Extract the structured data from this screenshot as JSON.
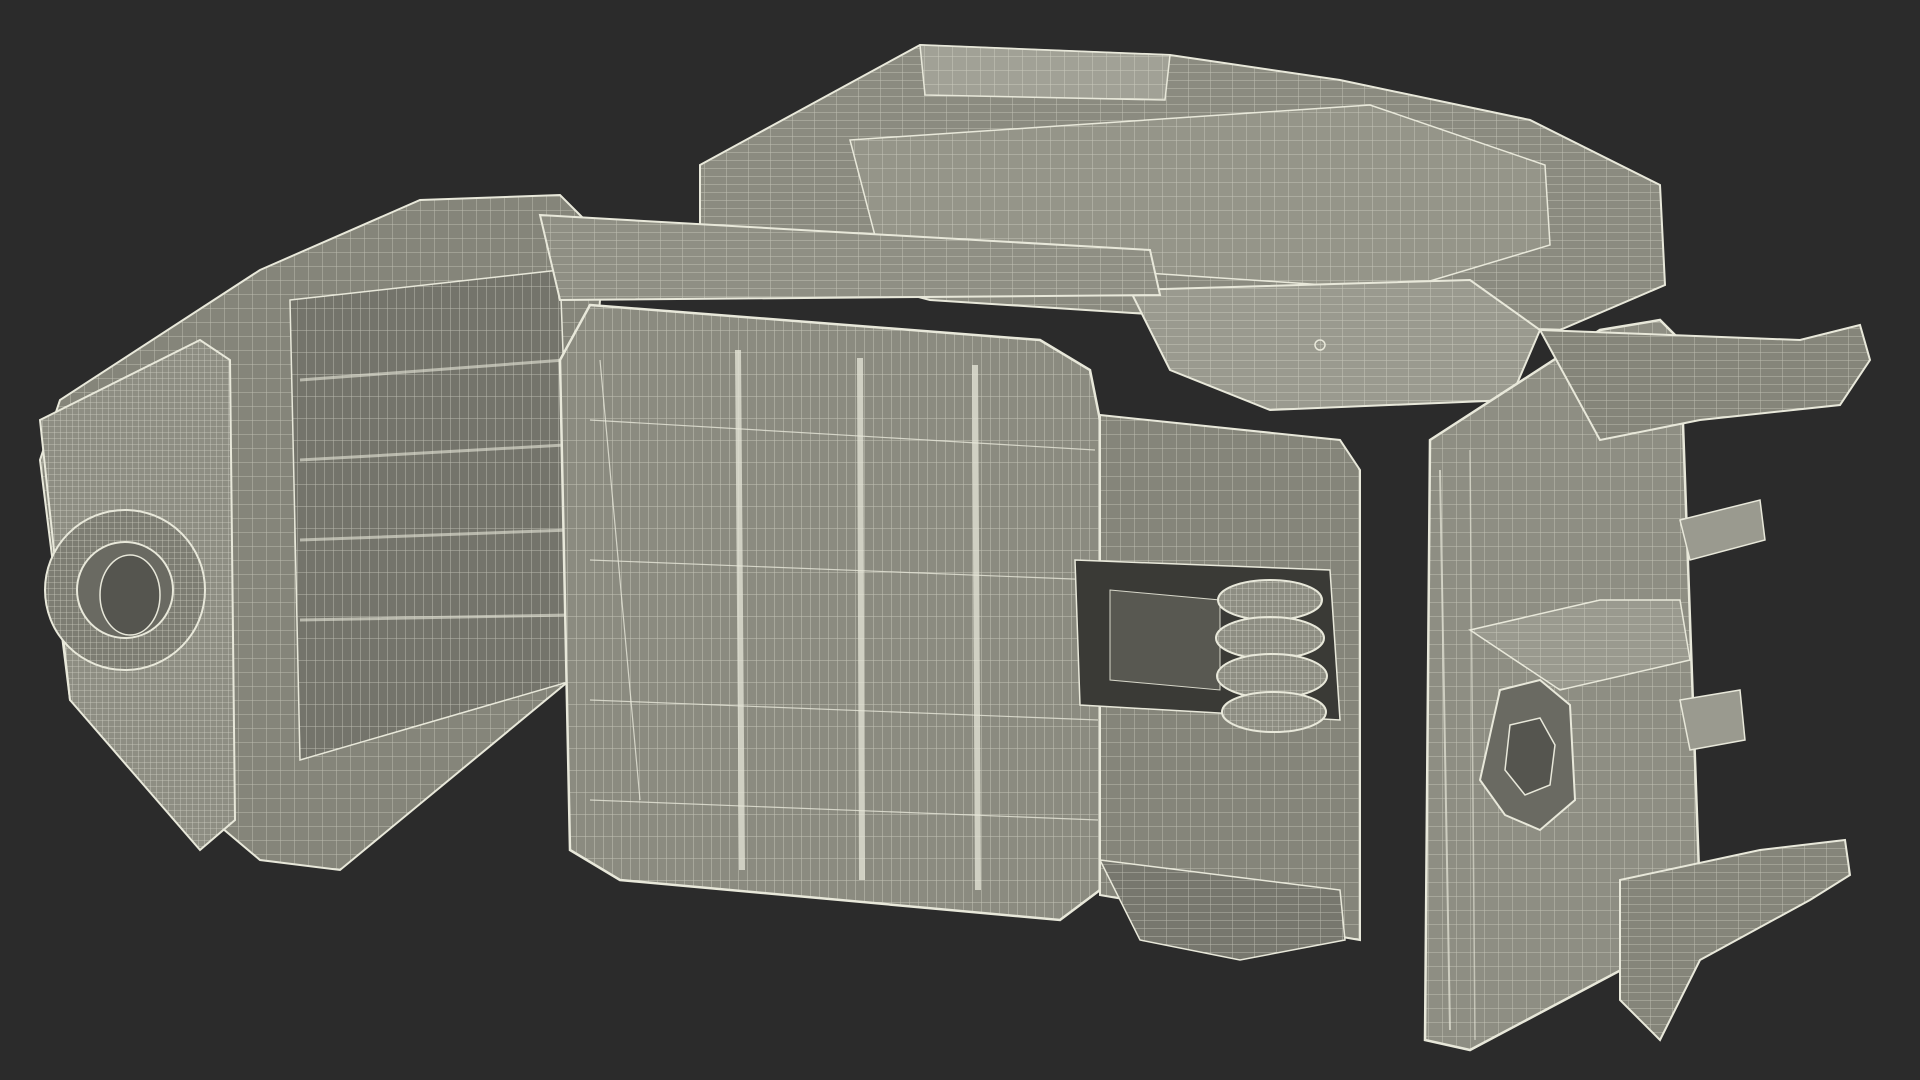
{
  "scene": {
    "background_color": "#2b2b2b",
    "surface_color": "#8b8b80",
    "surface_dark_color": "#6a6a62",
    "surface_light_color": "#a1a196",
    "wire_color": "#e8e8da",
    "subject": "wireframe-mechanical-part"
  }
}
